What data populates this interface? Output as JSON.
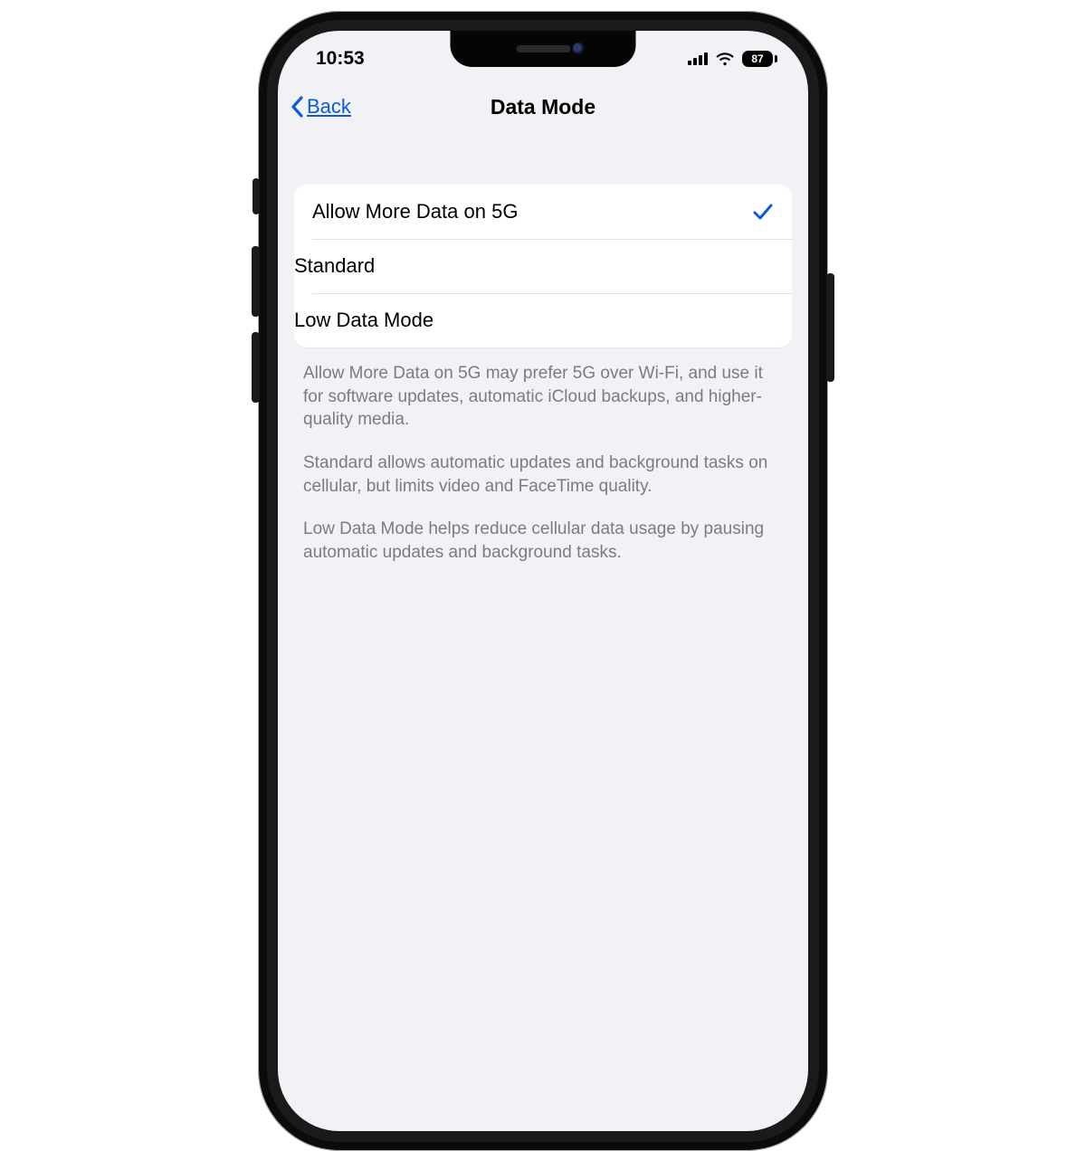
{
  "status": {
    "time": "10:53",
    "battery_percent": "87"
  },
  "nav": {
    "back_label": "Back",
    "title": "Data Mode"
  },
  "options": [
    {
      "label": "Allow More Data on 5G",
      "selected": true
    },
    {
      "label": "Standard",
      "selected": false
    },
    {
      "label": "Low Data Mode",
      "selected": false
    }
  ],
  "footer": {
    "p1": "Allow More Data on 5G may prefer 5G over Wi-Fi, and use it for software updates, automatic iCloud backups, and higher-quality media.",
    "p2": "Standard allows automatic updates and background tasks on cellular, but limits video and FaceTime quality.",
    "p3": "Low Data Mode helps reduce cellular data usage by pausing automatic updates and background tasks."
  },
  "colors": {
    "accent_blue": "#0a5bd6",
    "screen_bg": "#f2f2f6"
  }
}
